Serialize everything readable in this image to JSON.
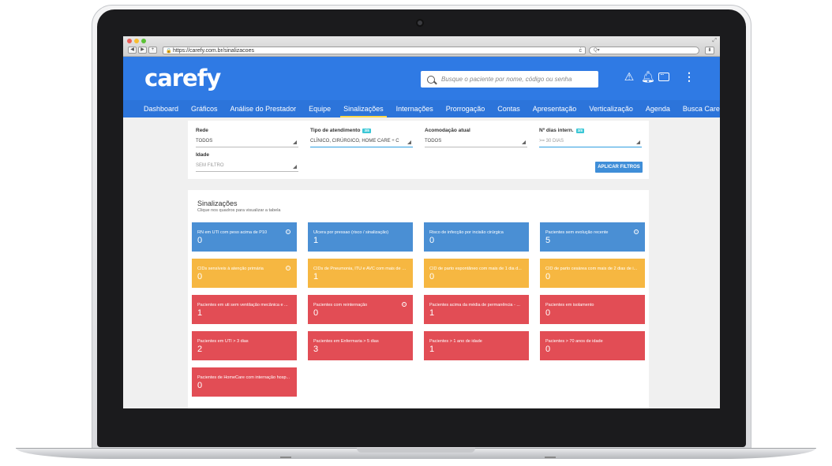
{
  "browser": {
    "url": "https://carefy.com.br/sinalizacoes",
    "nav_back": "◀",
    "nav_forward": "▶",
    "new_tab": "+",
    "reload": "ċ",
    "search_placeholder": "Q▾"
  },
  "app": {
    "logo": "carefy",
    "search_placeholder": "Busque o paciente por nome, código ou senha",
    "nav": [
      {
        "label": "Dashboard"
      },
      {
        "label": "Gráficos"
      },
      {
        "label": "Análise do Prestador"
      },
      {
        "label": "Equipe"
      },
      {
        "label": "Sinalizações",
        "active": true
      },
      {
        "label": "Internações"
      },
      {
        "label": "Prorrogação"
      },
      {
        "label": "Contas"
      },
      {
        "label": "Apresentação"
      },
      {
        "label": "Verticalização"
      },
      {
        "label": "Agenda"
      },
      {
        "label": "Busca Carefy"
      }
    ],
    "icons": [
      "warning-icon",
      "bell-icon",
      "chat-icon",
      "more-vertical-icon"
    ]
  },
  "filters": {
    "rede": {
      "label": "Rede",
      "value": "TODOS"
    },
    "tipo": {
      "label": "Tipo de atendimento",
      "tag": "3/8",
      "value": "CLÍNICO, CIRÚRGICO, HOME CARE ÷ C"
    },
    "acomodacao": {
      "label": "Acomodação atual",
      "value": "TODOS"
    },
    "dias": {
      "label": "Nº dias intern.",
      "tag": "3/8",
      "value": ">= 30 DIAS"
    },
    "idade": {
      "label": "Idade",
      "value": "SEM FILTRO"
    },
    "apply_label": "APLICAR FILTROS"
  },
  "panel": {
    "title": "Sinalizações",
    "subtitle": "Clique nos quadros para visualizar a tabela"
  },
  "cards": [
    {
      "label": "RN em UTI com peso acima de P10",
      "value": "0",
      "color": "#4a8fd4",
      "info": true
    },
    {
      "label": "Úlcera por pressao (risco / sinalização)",
      "value": "1",
      "color": "#4a8fd4",
      "info": false
    },
    {
      "label": "Risco de infecção por incisão cirúrgica",
      "value": "0",
      "color": "#4a8fd4",
      "info": false
    },
    {
      "label": "Pacientes sem evolução recente",
      "value": "5",
      "color": "#4a8fd4",
      "info": true
    },
    {
      "label": "CIDs sensíveis à atenção primária",
      "value": "0",
      "color": "#f6b741",
      "info": true
    },
    {
      "label": "CIDs de Pneumonia, ITU e AVC com mais de 3...",
      "value": "1",
      "color": "#f6b741",
      "info": false
    },
    {
      "label": "CID de parto espontâneo com mais de 1 dia d...",
      "value": "0",
      "color": "#f6b741",
      "info": false
    },
    {
      "label": "CID de parto cesárea com mais de 2 dias de i...",
      "value": "0",
      "color": "#f6b741",
      "info": false
    },
    {
      "label": "Pacientes em uti sem ventilação mecânica e ...",
      "value": "1",
      "color": "#e24d55",
      "info": false
    },
    {
      "label": "Pacientes com reinternação",
      "value": "0",
      "color": "#e24d55",
      "info": true
    },
    {
      "label": "Pacientes acima da média de permanência - ...",
      "value": "1",
      "color": "#e24d55",
      "info": false
    },
    {
      "label": "Pacientes em isolamento",
      "value": "0",
      "color": "#e24d55",
      "info": false
    },
    {
      "label": "Pacientes em UTI > 3 dias",
      "value": "2",
      "color": "#e24d55",
      "info": false
    },
    {
      "label": "Pacientes em Enfermaria > 5 dias",
      "value": "3",
      "color": "#e24d55",
      "info": false
    },
    {
      "label": "Pacientes > 1 ano de idade",
      "value": "1",
      "color": "#e24d55",
      "info": false
    },
    {
      "label": "Pacientes > 70 anos de idade",
      "value": "0",
      "color": "#e24d55",
      "info": false
    },
    {
      "label": "Pacientes de HomeCare com internação hosp...",
      "value": "0",
      "color": "#e24d55",
      "info": false
    }
  ]
}
